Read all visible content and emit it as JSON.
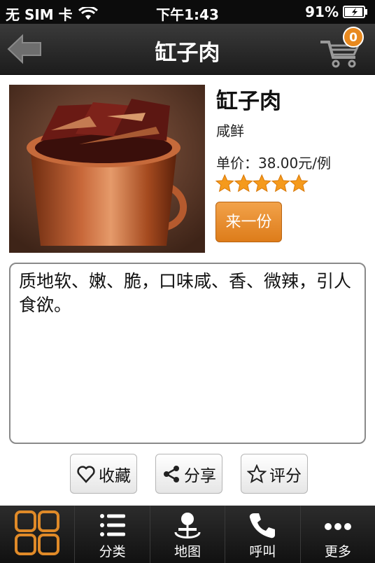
{
  "status_bar": {
    "carrier": "无 SIM 卡",
    "time": "下午1:43",
    "battery": "91%"
  },
  "nav": {
    "title": "缸子肉",
    "cart_count": "0",
    "back_icon": "back-arrow-icon",
    "cart_icon": "cart-icon"
  },
  "dish": {
    "name": "缸子肉",
    "taste": "咸鲜",
    "price": "单价：38.00元/例",
    "rating": 5,
    "order_button": "来一份",
    "description": "质地软、嫩、脆，口味咸、香、微辣，引人食欲。"
  },
  "actions": {
    "favorite": "收藏",
    "share": "分享",
    "rate": "评分"
  },
  "tabbar": {
    "items": [
      {
        "label": "",
        "icon": "grid-icon"
      },
      {
        "label": "分类",
        "icon": "list-icon"
      },
      {
        "label": "地图",
        "icon": "map-person-icon"
      },
      {
        "label": "呼叫",
        "icon": "phone-icon"
      },
      {
        "label": "更多",
        "icon": "more-icon"
      }
    ]
  },
  "colors": {
    "accent": "#e8891f",
    "navbar": "#262626",
    "tabbar": "#141414"
  }
}
